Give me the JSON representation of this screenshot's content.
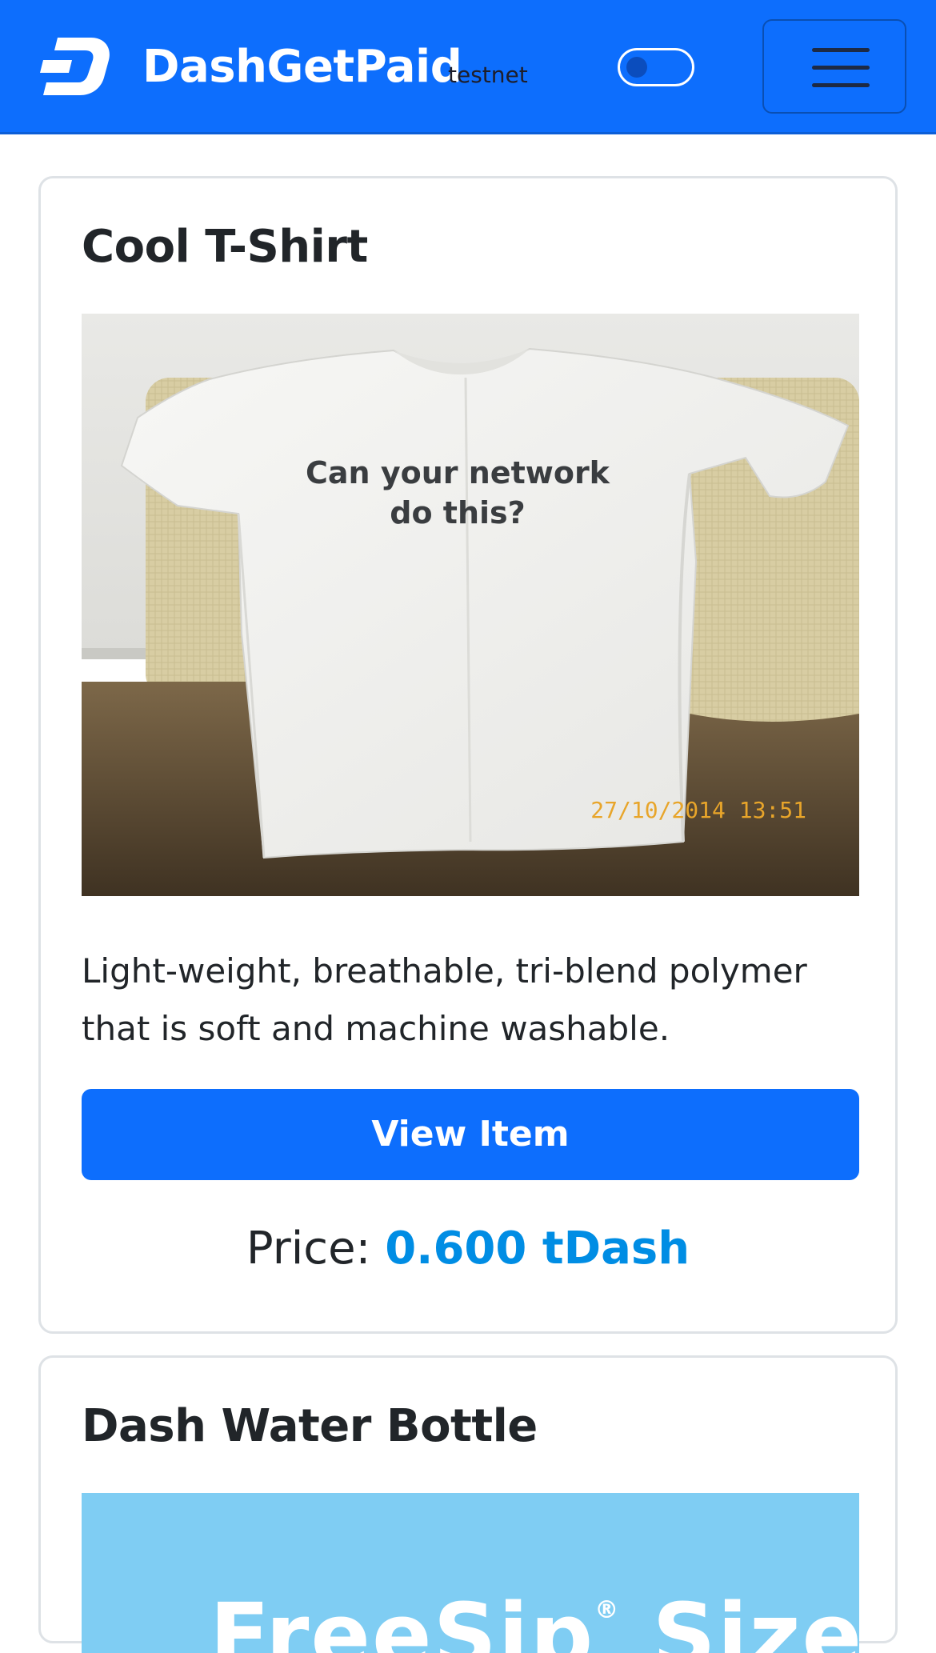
{
  "navbar": {
    "brand_name": "DashGetPaid",
    "network_label": "testnet",
    "theme_toggle_state": "off",
    "menu_icon": "hamburger-icon",
    "colors": {
      "background": "#0d6efd"
    }
  },
  "products": [
    {
      "title": "Cool T-Shirt",
      "image": {
        "shirt_text": "Can your network\ndo this?",
        "shirt_text_line1": "Can your network",
        "shirt_text_line2": "do this?",
        "date_stamp": "27/10/2014  13:51"
      },
      "description": "Light-weight, breathable, tri-blend polymer that is soft and machine washable.",
      "button_label": "View Item",
      "price_label": "Price:",
      "price_value": "0.600 tDash"
    },
    {
      "title": "Dash Water Bottle",
      "image": {
        "text": "FreeSip",
        "text_suffix": "Sizes",
        "registered_mark": "®"
      }
    }
  ],
  "colors": {
    "primary": "#0d6efd",
    "price": "#008de4",
    "card_border": "#dee2e6"
  }
}
